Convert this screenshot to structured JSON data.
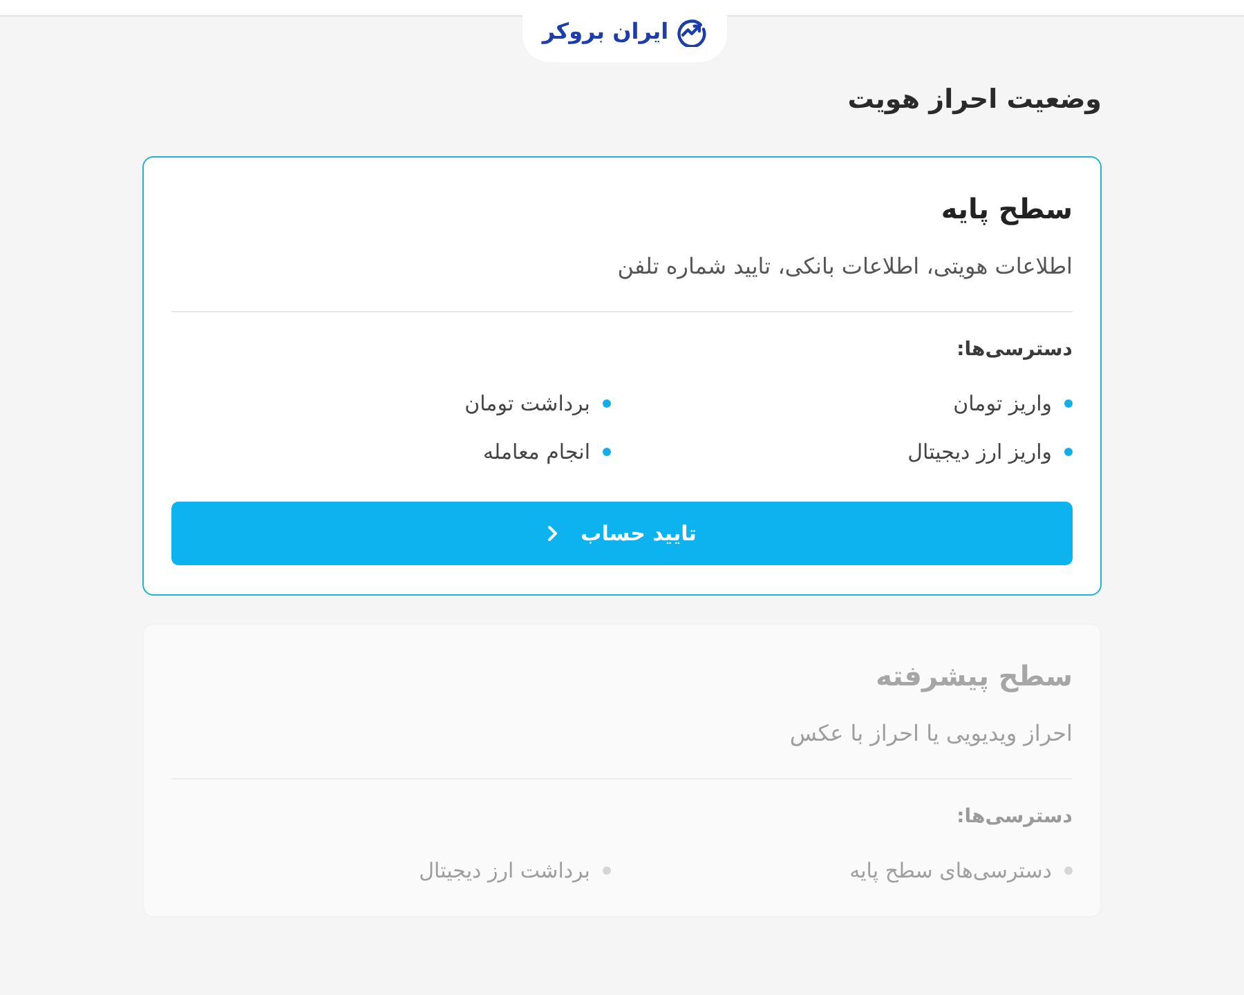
{
  "header": {
    "logo_text": "ایران بروکر"
  },
  "page_title": "وضعیت احراز هویت",
  "levels": [
    {
      "title": "سطح پایه",
      "description": "اطلاعات هویتی، اطلاعات بانکی، تایید شماره تلفن",
      "access_label": "دسترسی‌ها:",
      "access_items": [
        "واریز تومان",
        "برداشت تومان",
        "واریز ارز دیجیتال",
        "انجام معامله"
      ],
      "disabled": false,
      "button": {
        "label": "تایید حساب"
      }
    },
    {
      "title": "سطح پیشرفته",
      "description": "احراز ویدیویی یا احراز با عکس",
      "access_label": "دسترسی‌ها:",
      "access_items": [
        "دسترسی‌های سطح پایه",
        "برداشت ارز دیجیتال"
      ],
      "disabled": true
    }
  ]
}
